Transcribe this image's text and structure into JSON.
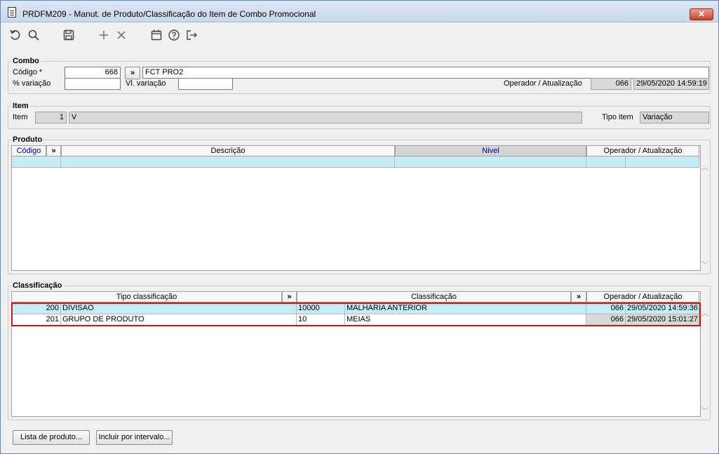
{
  "window": {
    "title": "PRDFM209 - Manut. de Produto/Classificação do Item de Combo Promocional",
    "close_label": "✕"
  },
  "toolbar": {
    "icons": [
      "undo-icon",
      "search-icon",
      "save-icon",
      "add-icon",
      "delete-icon",
      "calendar-icon",
      "help-icon",
      "exit-icon"
    ]
  },
  "combo": {
    "title": "Combo",
    "codigo_label": "Código *",
    "codigo_value": "668",
    "lookup_label": "»",
    "description_value": "FCT PRO2",
    "pct_label": "% variação",
    "pct_value": "",
    "vl_label": "Vl. variação",
    "vl_value": "",
    "operador_label": "Operador / Atualização",
    "operador_value": "066",
    "atualizacao_value": "29/05/2020 14:59:19"
  },
  "item": {
    "title": "Item",
    "item_label": "Item",
    "item_value": "1",
    "item_desc": "V",
    "tipo_label": "Tipo item",
    "tipo_value": "Variação"
  },
  "produto": {
    "title": "Produto",
    "headers": {
      "codigo": "Código",
      "lookup": "»",
      "descricao": "Descrição",
      "nivel": "Nivel",
      "operador": "Operador / Atualização"
    }
  },
  "classificacao": {
    "title": "Classificação",
    "headers": {
      "tipo": "Tipo classificação",
      "lookup1": "»",
      "classificacao": "Classificação",
      "lookup2": "»",
      "operador": "Operador / Atualização"
    },
    "rows": [
      {
        "code": "200",
        "tipo": "DIVISAO",
        "class_code": "10000",
        "class_desc": "MALHARIA ANTERIOR",
        "operador": "066",
        "data": "29/05/2020 14:59:36"
      },
      {
        "code": "201",
        "tipo": "GRUPO DE PRODUTO",
        "class_code": "10",
        "class_desc": "MEIAS",
        "operador": "066",
        "data": "29/05/2020 15:01:27"
      }
    ]
  },
  "footer": {
    "lista_label": "Lista de produto...",
    "incluir_label": "Incluir por intervalo..."
  }
}
